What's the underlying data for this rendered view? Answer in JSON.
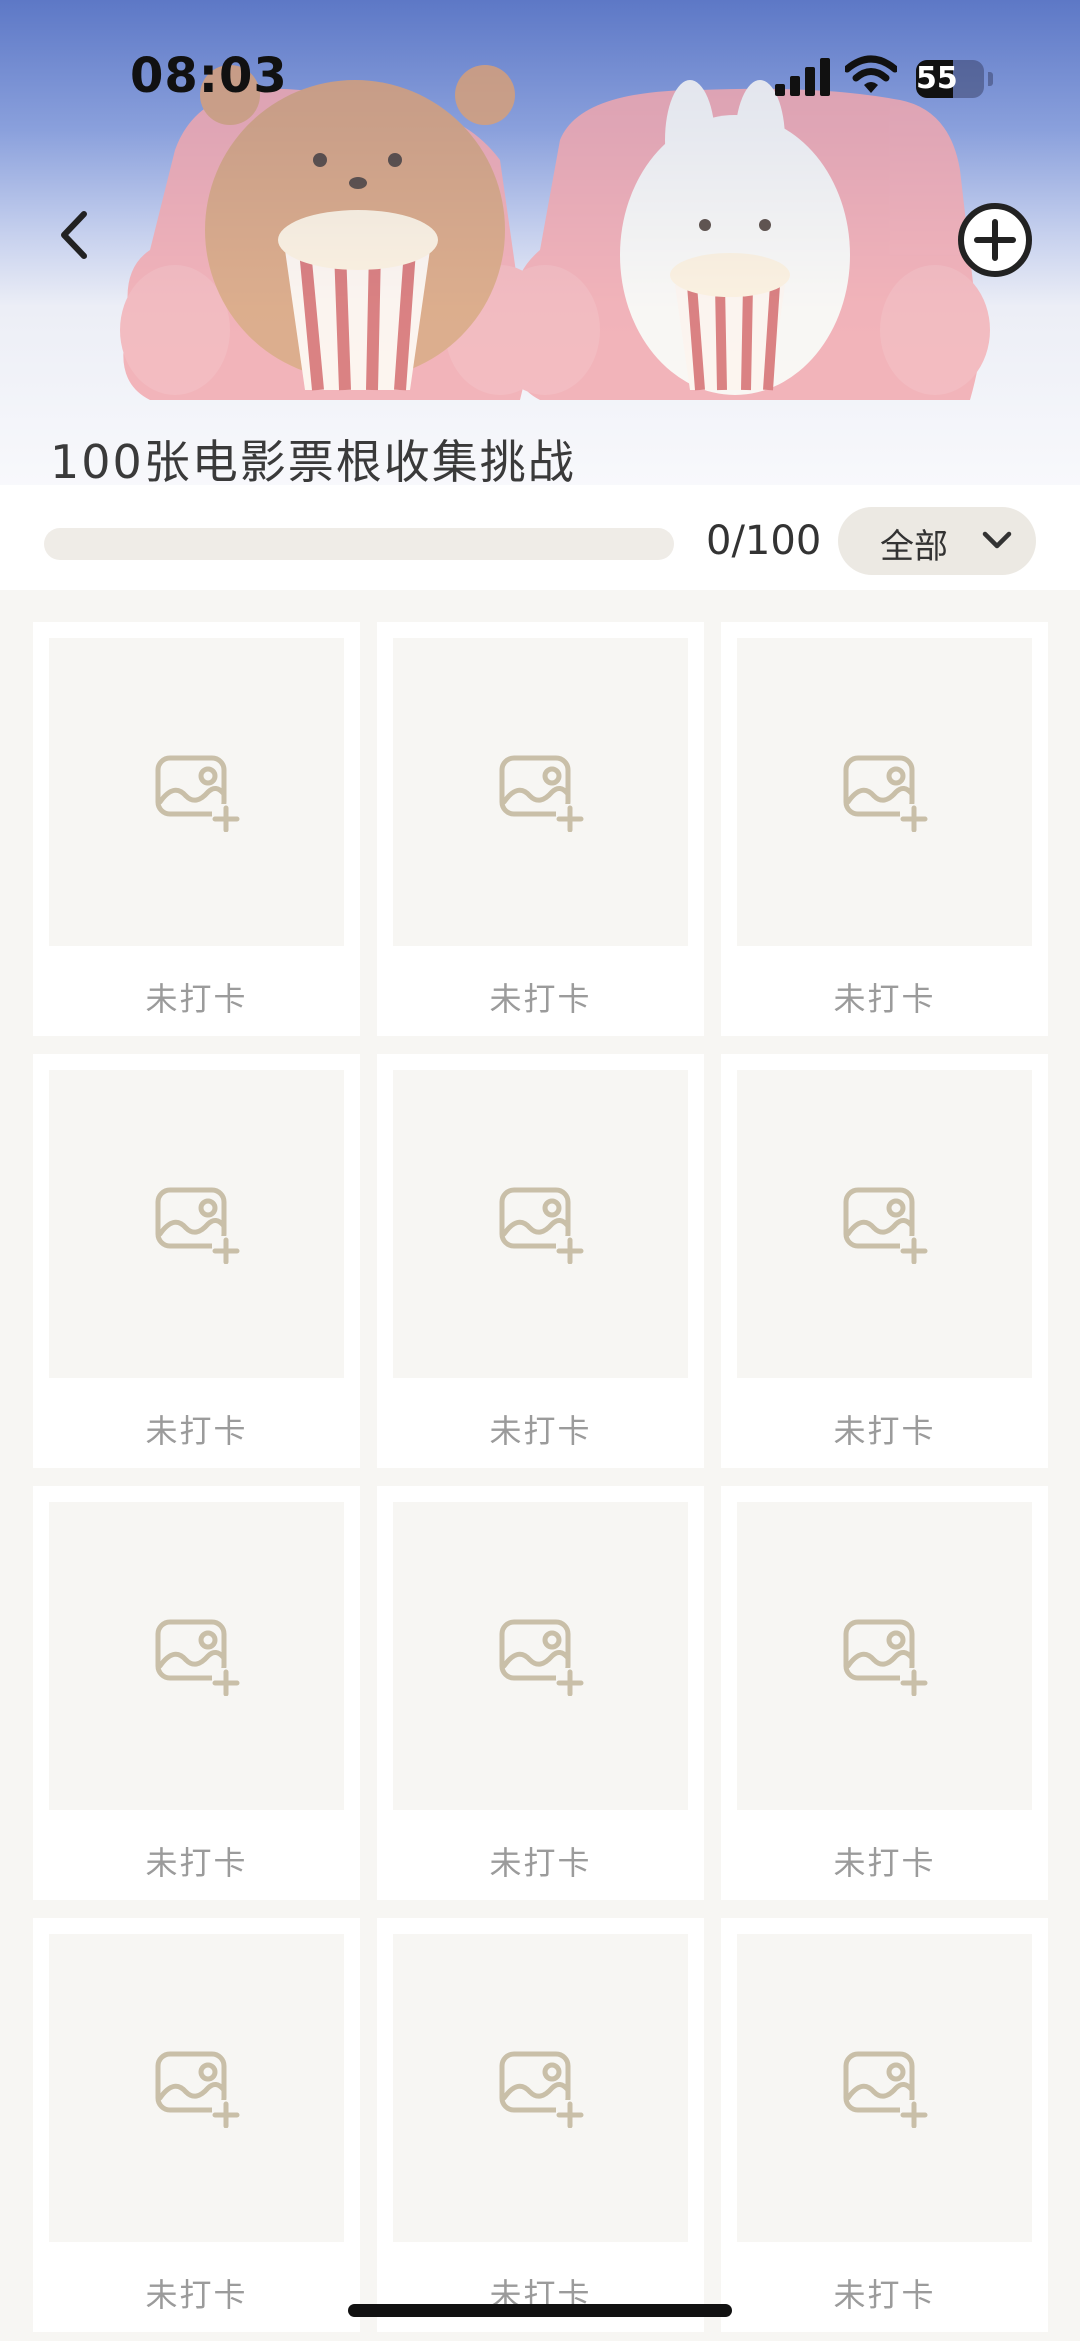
{
  "status_bar": {
    "time": "08:03",
    "battery_level": "55",
    "battery_percent": 55
  },
  "header": {
    "title": "100张电影票根收集挑战",
    "back_icon": "chevron-left-icon",
    "add_icon": "plus-circle-icon"
  },
  "progress": {
    "text": "0/100",
    "completed": 0,
    "total": 100
  },
  "filter": {
    "selected": "全部",
    "icon": "chevron-down-icon"
  },
  "cards": [
    {
      "status": "未打卡"
    },
    {
      "status": "未打卡"
    },
    {
      "status": "未打卡"
    },
    {
      "status": "未打卡"
    },
    {
      "status": "未打卡"
    },
    {
      "status": "未打卡"
    },
    {
      "status": "未打卡"
    },
    {
      "status": "未打卡"
    },
    {
      "status": "未打卡"
    },
    {
      "status": "未打卡"
    },
    {
      "status": "未打卡"
    },
    {
      "status": "未打卡"
    }
  ],
  "colors": {
    "header_top": "#5d78c6",
    "placeholder_icon": "#c9bfa8",
    "card_label": "#9b9b9b",
    "page_bg": "#f7f6f3"
  }
}
